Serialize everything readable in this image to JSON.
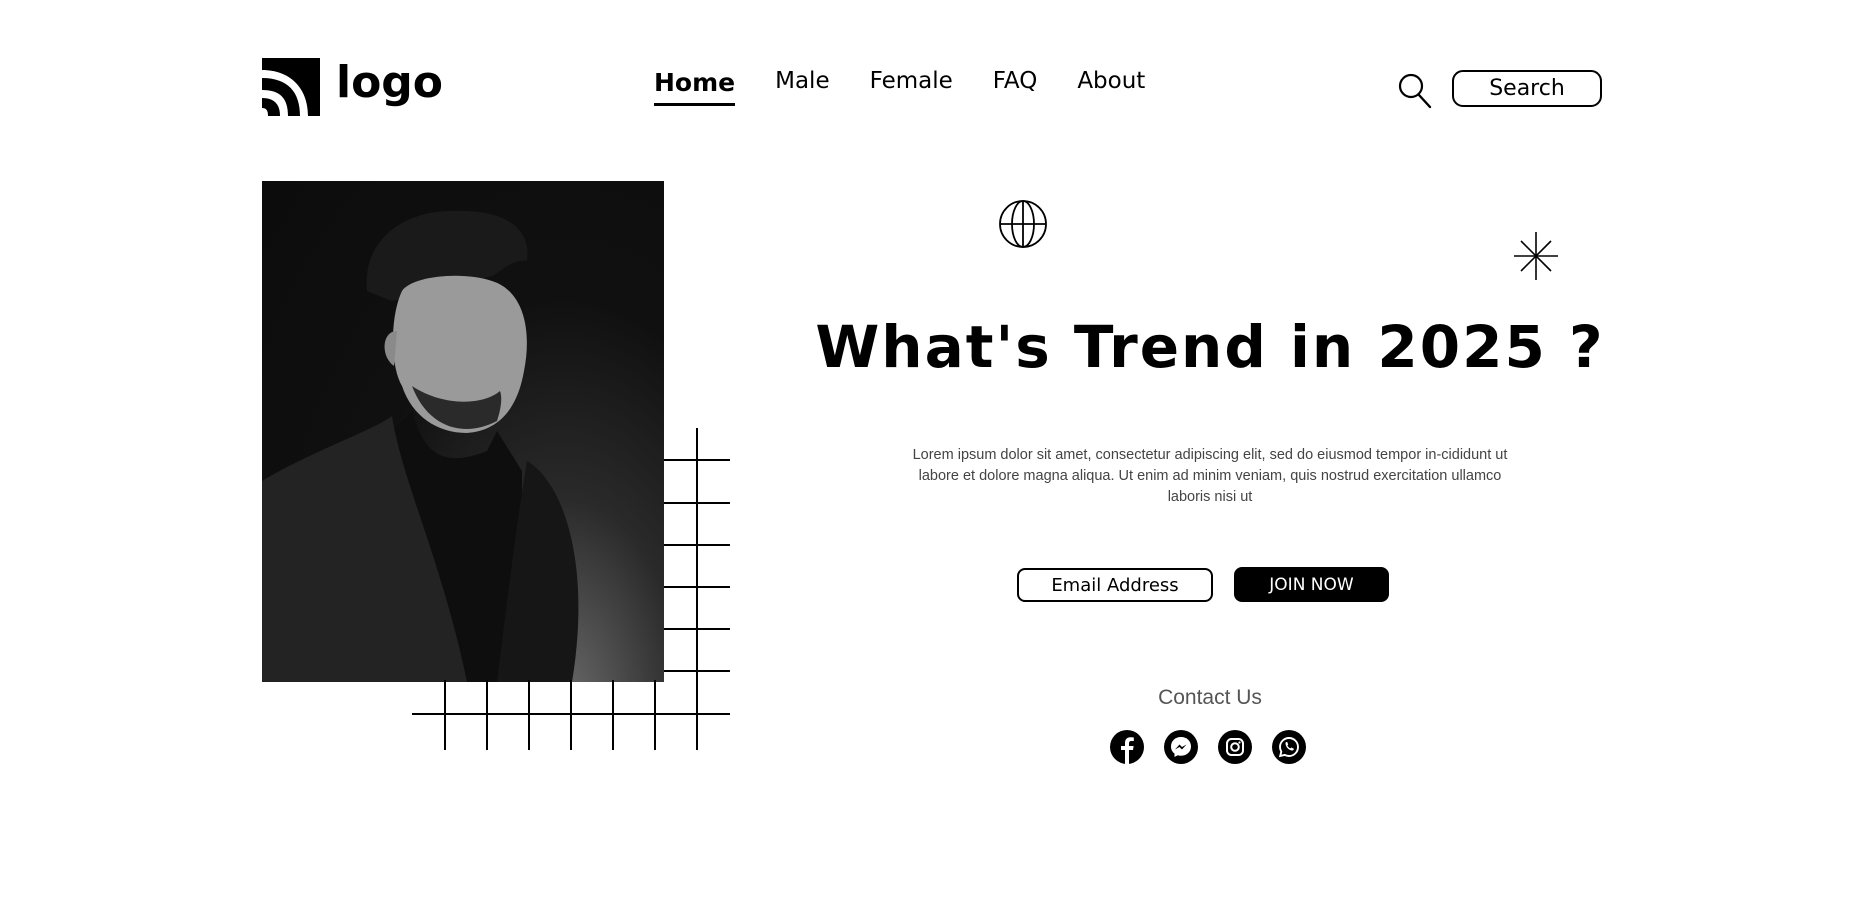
{
  "header": {
    "logo_text": "logo",
    "nav": [
      {
        "label": "Home",
        "active": true
      },
      {
        "label": "Male",
        "active": false
      },
      {
        "label": "Female",
        "active": false
      },
      {
        "label": "FAQ",
        "active": false
      },
      {
        "label": "About",
        "active": false
      }
    ],
    "search_label": "Search",
    "search_icon": "search-icon"
  },
  "hero": {
    "image": "portrait-photo",
    "headline": "What's Trend in 2025 ?",
    "description": "Lorem ipsum dolor sit amet, consectetur adipiscing elit, sed do eiusmod tempor in-cididunt ut labore et dolore magna aliqua. Ut enim ad minim veniam, quis nostrud exercitation ullamco laboris nisi ut",
    "email_placeholder": "Email Address",
    "join_label": "JOIN NOW"
  },
  "contact": {
    "title": "Contact Us",
    "socials": [
      "facebook-icon",
      "messenger-icon",
      "instagram-icon",
      "whatsapp-icon"
    ]
  },
  "colors": {
    "text": "#000000",
    "background": "#ffffff",
    "muted": "#555555"
  }
}
